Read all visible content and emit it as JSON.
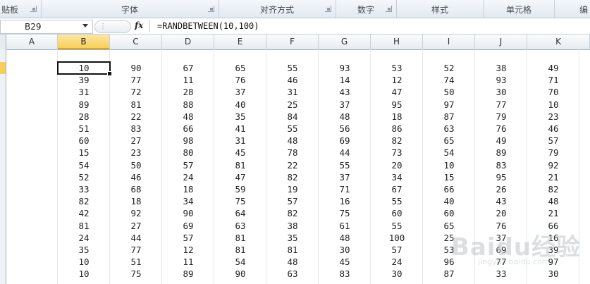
{
  "ribbon": {
    "groups": [
      {
        "label": "贴板"
      },
      {
        "label": "字体"
      },
      {
        "label": "对齐方式"
      },
      {
        "label": "数字"
      },
      {
        "label": "样式"
      },
      {
        "label": "单元格"
      },
      {
        "label": "编"
      }
    ]
  },
  "formula_bar": {
    "name_box": "B29",
    "fx_label": "fx",
    "formula": "=RANDBETWEEN(10,100)"
  },
  "sheet": {
    "columns": [
      "A",
      "B",
      "C",
      "D",
      "E",
      "F",
      "G",
      "H",
      "I",
      "J",
      "K"
    ],
    "active_column": "B",
    "selected_cell_value": "10",
    "rows": [
      [
        "10",
        "90",
        "67",
        "65",
        "55",
        "93",
        "53",
        "52",
        "38",
        "49"
      ],
      [
        "39",
        "77",
        "11",
        "76",
        "46",
        "14",
        "12",
        "74",
        "93",
        "71"
      ],
      [
        "31",
        "72",
        "28",
        "37",
        "31",
        "43",
        "47",
        "50",
        "30",
        "70"
      ],
      [
        "89",
        "81",
        "88",
        "40",
        "25",
        "37",
        "95",
        "97",
        "77",
        "10"
      ],
      [
        "28",
        "22",
        "48",
        "35",
        "84",
        "48",
        "18",
        "87",
        "79",
        "23"
      ],
      [
        "51",
        "83",
        "66",
        "41",
        "55",
        "56",
        "86",
        "63",
        "76",
        "46"
      ],
      [
        "60",
        "27",
        "98",
        "31",
        "48",
        "69",
        "82",
        "65",
        "49",
        "57"
      ],
      [
        "15",
        "23",
        "80",
        "45",
        "78",
        "44",
        "73",
        "54",
        "89",
        "79"
      ],
      [
        "54",
        "50",
        "57",
        "81",
        "22",
        "55",
        "20",
        "10",
        "83",
        "92"
      ],
      [
        "52",
        "46",
        "24",
        "47",
        "82",
        "37",
        "34",
        "15",
        "95",
        "21"
      ],
      [
        "33",
        "68",
        "18",
        "59",
        "19",
        "71",
        "67",
        "66",
        "26",
        "82"
      ],
      [
        "82",
        "18",
        "34",
        "75",
        "57",
        "16",
        "55",
        "40",
        "43",
        "48"
      ],
      [
        "42",
        "92",
        "90",
        "64",
        "82",
        "75",
        "60",
        "60",
        "20",
        "21"
      ],
      [
        "81",
        "27",
        "69",
        "63",
        "38",
        "61",
        "55",
        "65",
        "76",
        "66"
      ],
      [
        "24",
        "44",
        "57",
        "81",
        "35",
        "48",
        "100",
        "25",
        "37",
        "16"
      ],
      [
        "35",
        "77",
        "12",
        "81",
        "81",
        "30",
        "57",
        "53",
        "69",
        "39"
      ],
      [
        "10",
        "51",
        "11",
        "54",
        "48",
        "45",
        "24",
        "96",
        "77",
        "97"
      ],
      [
        "10",
        "75",
        "89",
        "90",
        "63",
        "83",
        "30",
        "87",
        "33",
        "30"
      ]
    ]
  },
  "watermark": {
    "logo": "Baidu经验",
    "sub": "jingyan.baidu.com"
  }
}
